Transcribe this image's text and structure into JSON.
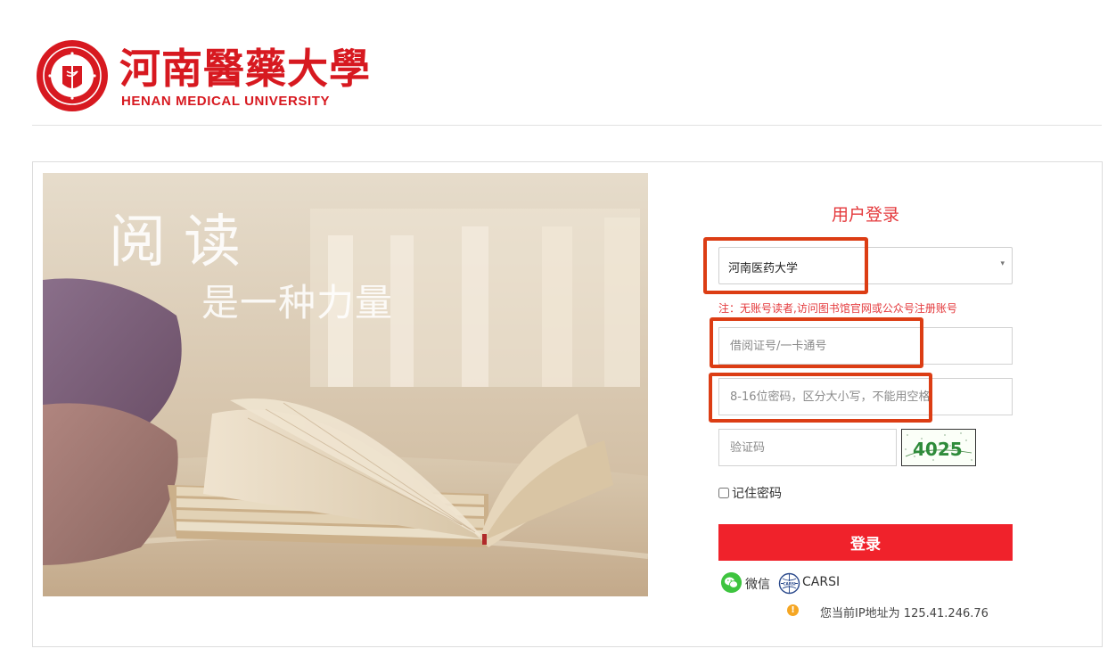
{
  "header": {
    "logo_seal_name": "university-seal",
    "logo_cn": "河南醫藥大學",
    "logo_en": "HENAN MEDICAL UNIVERSITY"
  },
  "banner": {
    "line1": "阅读",
    "line2": "是一种力量"
  },
  "login": {
    "title": "用户登录",
    "school_select": {
      "value": "河南医药大学",
      "arrow": "▾"
    },
    "note": "注：无账号读者,访问图书馆官网或公众号注册账号",
    "username": {
      "placeholder": "借阅证号/一卡通号",
      "value": ""
    },
    "password": {
      "placeholder": "8-16位密码，区分大小写，不能用空格",
      "value": ""
    },
    "captcha": {
      "placeholder": "验证码",
      "value": "",
      "image_text": "4025"
    },
    "remember_label": "记住密码",
    "submit_label": "登录",
    "alt_login": {
      "wechat_label": "微信",
      "carsi_label": "CARSI"
    },
    "ip_notice": "您当前IP地址为 125.41.246.76"
  },
  "colors": {
    "brand_red": "#d71920",
    "button_red": "#f0222b",
    "highlight": "#dc3d14",
    "wechat_green": "#3ec43f"
  }
}
